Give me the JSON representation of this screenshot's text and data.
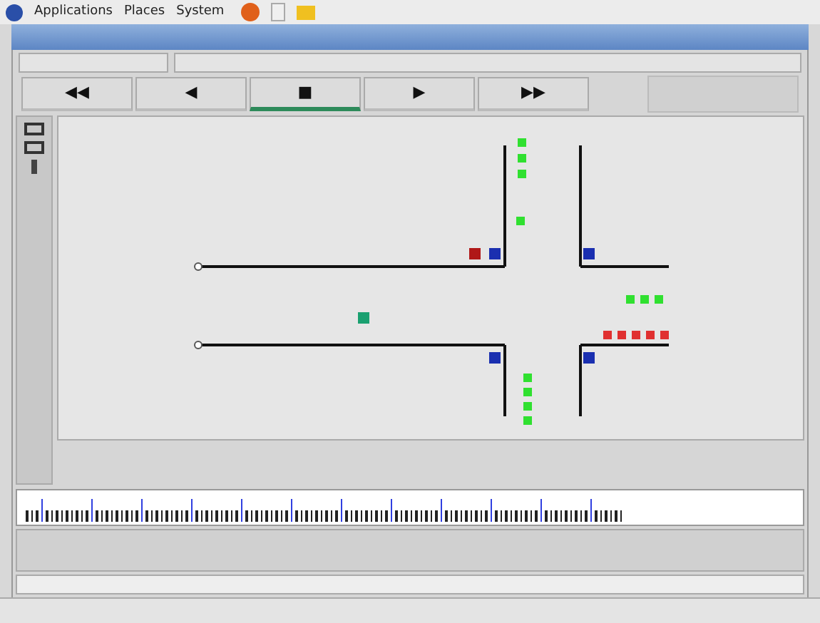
{
  "top_panel": {
    "menus": [
      "Applications",
      "Places",
      "System"
    ]
  },
  "transport": {
    "buttons": [
      {
        "symbol": "◀◀",
        "selected": false
      },
      {
        "symbol": "◀",
        "selected": false
      },
      {
        "symbol": "■",
        "selected": true
      },
      {
        "symbol": "▶",
        "selected": false
      },
      {
        "symbol": "▶▶",
        "selected": false
      }
    ]
  }
}
